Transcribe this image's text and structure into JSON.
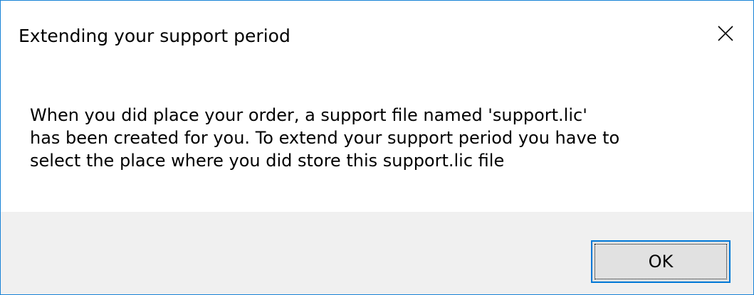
{
  "window": {
    "title": "Extending your support period",
    "close_icon": "close-icon"
  },
  "message": {
    "lines": [
      "When you did place your order, a support file named 'support.lic'",
      "has been created for you. To extend your support period you have to",
      "select the place where you did store this support.lic file"
    ]
  },
  "buttons": {
    "ok_label": "OK"
  },
  "colors": {
    "window_border": "#1883d7",
    "footer_bg": "#f0f0f0",
    "button_bg": "#e1e1e1",
    "button_focus_border": "#0078d7"
  }
}
